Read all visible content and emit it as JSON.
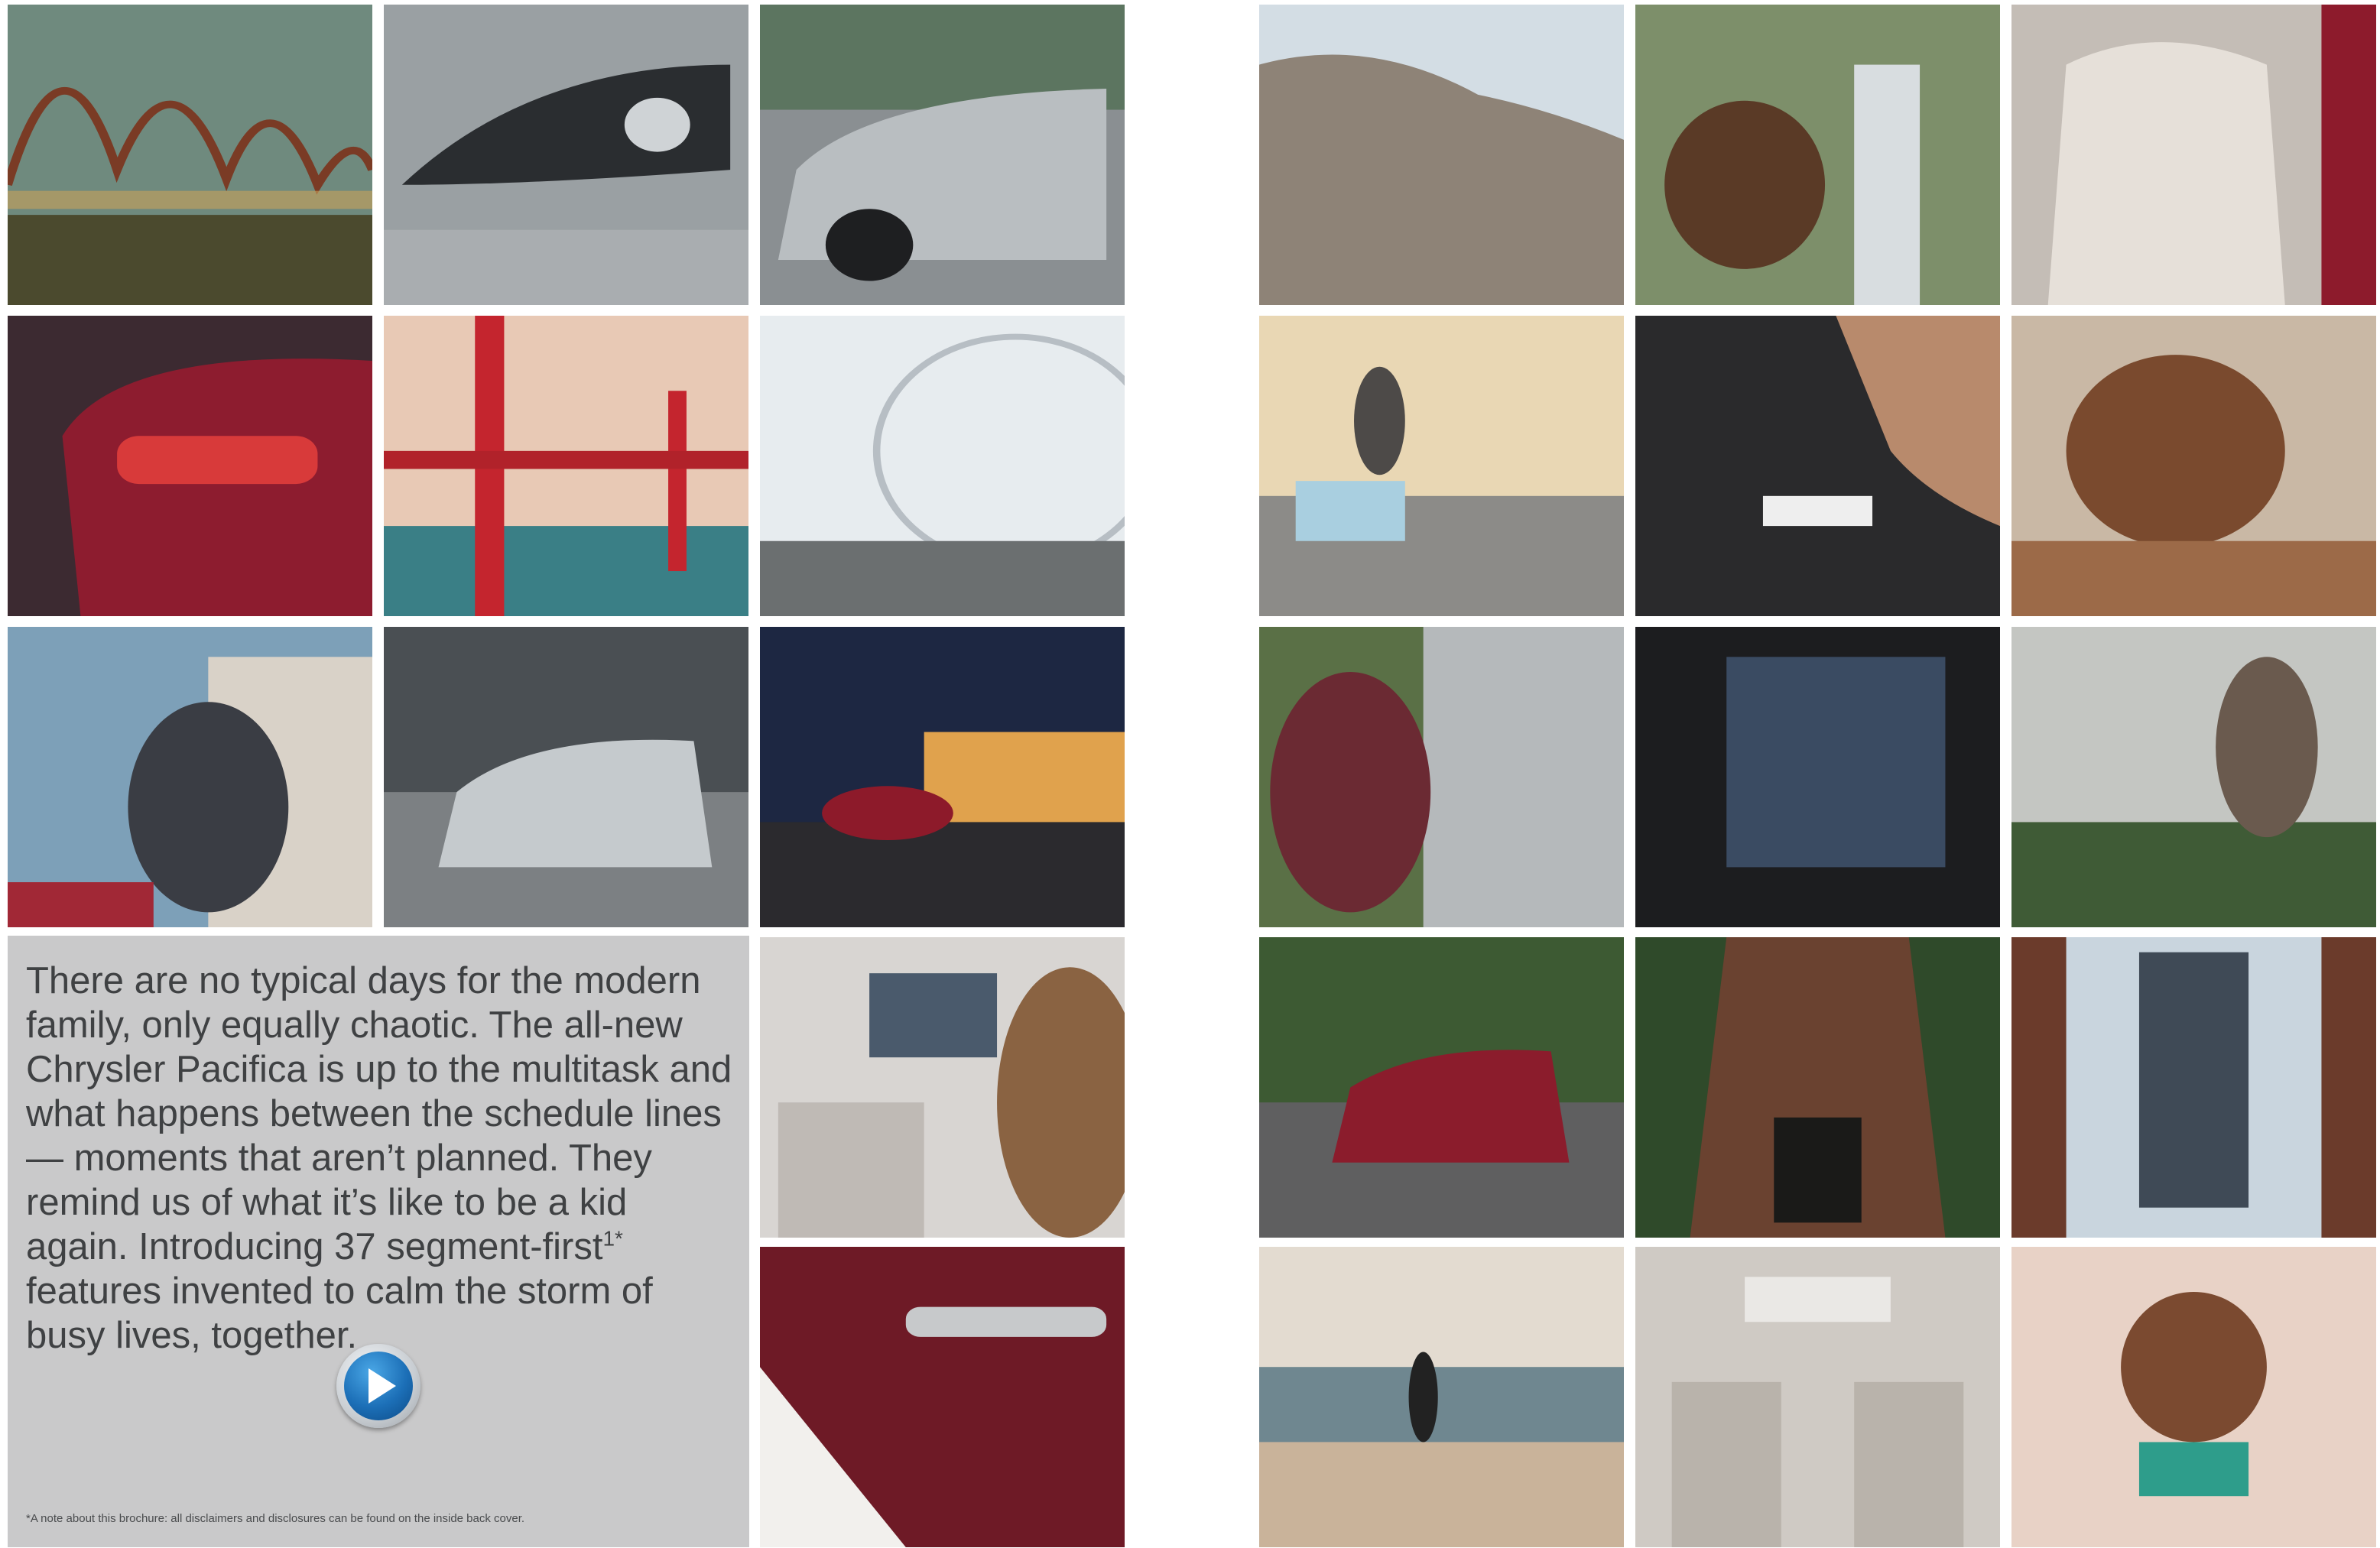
{
  "intro": {
    "paragraph_before_sup": "There are no typical days for the modern family, only equally chaotic. The all-new Chrysler Pacifica is up to the multitask and what happens between the schedule lines — moments that aren’t planned. They remind us of what it’s like to be a kid again. Introducing 37 segment-first",
    "sup": "1*",
    "paragraph_after_sup": " features invented to calm the storm of busy lives, together."
  },
  "disclaimer": "*A note about this brochure: all disclaimers and disclosures can be found on the inside back cover.",
  "play_button": {
    "icon": "play-icon"
  },
  "colors": {
    "panel_bg": "#c9c9ca",
    "text": "#3f4143",
    "play_blue": "#1c6fb7"
  }
}
